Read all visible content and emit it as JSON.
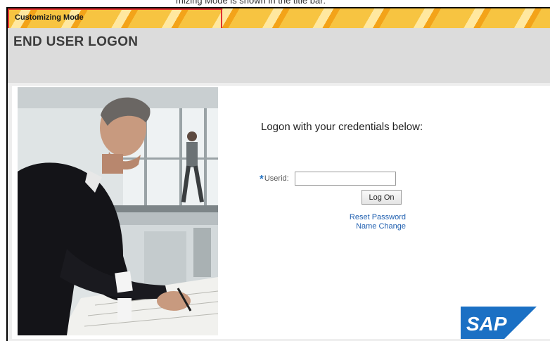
{
  "mode_bar": {
    "label": "Customizing Mode"
  },
  "header": {
    "title": "END USER LOGON"
  },
  "form": {
    "heading": "Logon with your credentials below:",
    "userid_label": "Userid:",
    "userid_value": "",
    "required_marker": "*",
    "logon_button": "Log On"
  },
  "links": {
    "reset_password": "Reset Password",
    "name_change": "Name Change"
  },
  "logo": {
    "text": "SAP"
  },
  "colors": {
    "mode_bar_primary": "#f7c441",
    "mode_bar_stripe": "#f3a319",
    "highlight_border": "#e03030",
    "header_background": "#dcdcdc",
    "link": "#1f5fb0",
    "required_marker": "#1f6fc1",
    "sap_logo": "#1b70c4"
  },
  "icons": {
    "photo": "businessman-drawing-photo",
    "logo": "sap-logo"
  }
}
